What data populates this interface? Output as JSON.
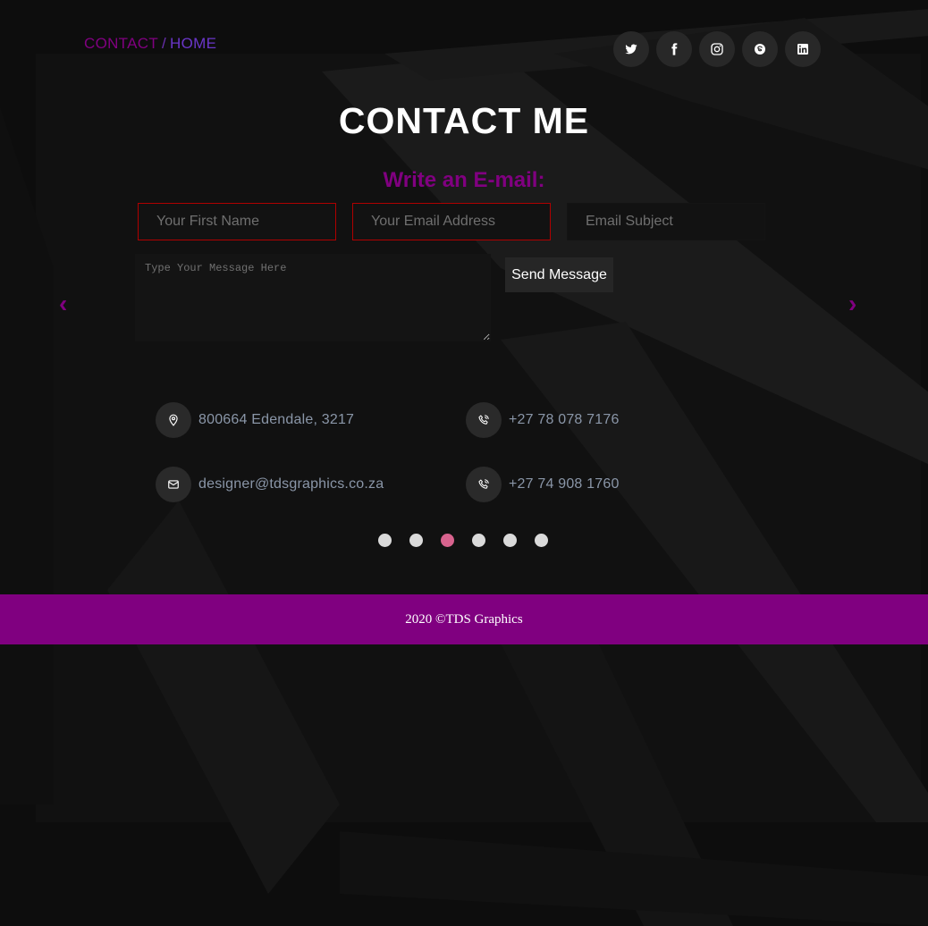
{
  "breadcrumb": {
    "current": "CONTACT",
    "separator": "/",
    "home": "HOME"
  },
  "socials": [
    {
      "name": "twitter-icon"
    },
    {
      "name": "facebook-icon"
    },
    {
      "name": "instagram-icon"
    },
    {
      "name": "skype-icon"
    },
    {
      "name": "linkedin-icon"
    }
  ],
  "page_title": "CONTACT ME",
  "form": {
    "heading": "Write an E-mail:",
    "first_name_placeholder": "Your First Name",
    "email_placeholder": "Your Email Address",
    "subject_placeholder": "Email Subject",
    "message_placeholder": "Type Your Message Here",
    "send_label": "Send Message"
  },
  "carousel": {
    "prev_label": "‹",
    "next_label": "›",
    "slide_count": 6,
    "active_slide": 3
  },
  "contact": {
    "address": "800664 Edendale, 3217",
    "phone_1": "+27 78 078 7176",
    "email": "designer@tdsgraphics.co.za",
    "phone_2": "+27 74 908 1760"
  },
  "footer": {
    "text": "2020 ©TDS Graphics"
  },
  "colors": {
    "accent": "#800080",
    "invalid_border": "#b00000",
    "active_dot": "#d8638e",
    "background": "#0c0c0c"
  }
}
